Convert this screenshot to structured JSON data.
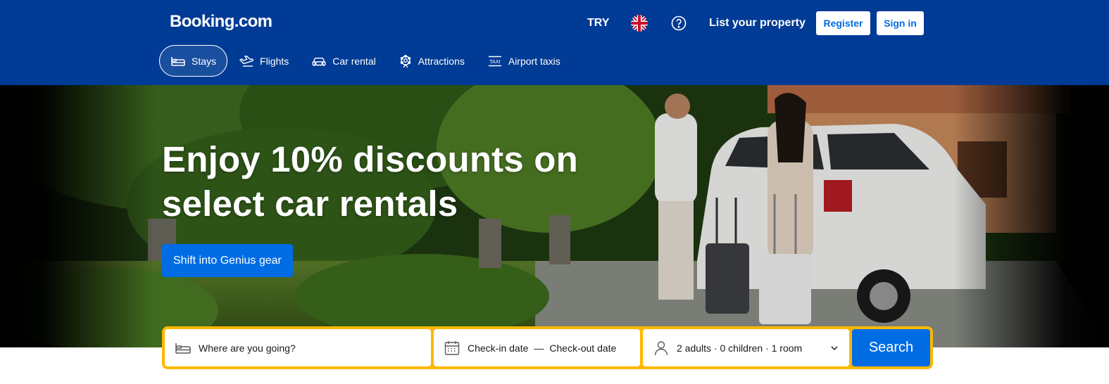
{
  "header": {
    "logo": "Booking.com",
    "currency": "TRY",
    "language_flag": "uk-flag-icon",
    "help_icon": "help-icon",
    "list_property": "List your property",
    "register": "Register",
    "sign_in": "Sign in",
    "background": "#003b95"
  },
  "nav": {
    "items": [
      {
        "label": "Stays",
        "icon": "bed-icon",
        "active": true
      },
      {
        "label": "Flights",
        "icon": "plane-icon",
        "active": false
      },
      {
        "label": "Car rental",
        "icon": "car-icon",
        "active": false
      },
      {
        "label": "Attractions",
        "icon": "attractions-icon",
        "active": false
      },
      {
        "label": "Airport taxis",
        "icon": "taxi-icon",
        "active": false
      }
    ]
  },
  "hero": {
    "headline": "Enjoy 10% discounts on select car rentals",
    "cta": "Shift into Genius gear"
  },
  "search": {
    "destination_placeholder": "Where are you going?",
    "check_in": "Check-in date",
    "separator": "—",
    "check_out": "Check-out date",
    "occupancy": "2 adults · 0 children · 1 room",
    "button": "Search",
    "border_color": "#ffb700",
    "accent": "#006ce4"
  }
}
